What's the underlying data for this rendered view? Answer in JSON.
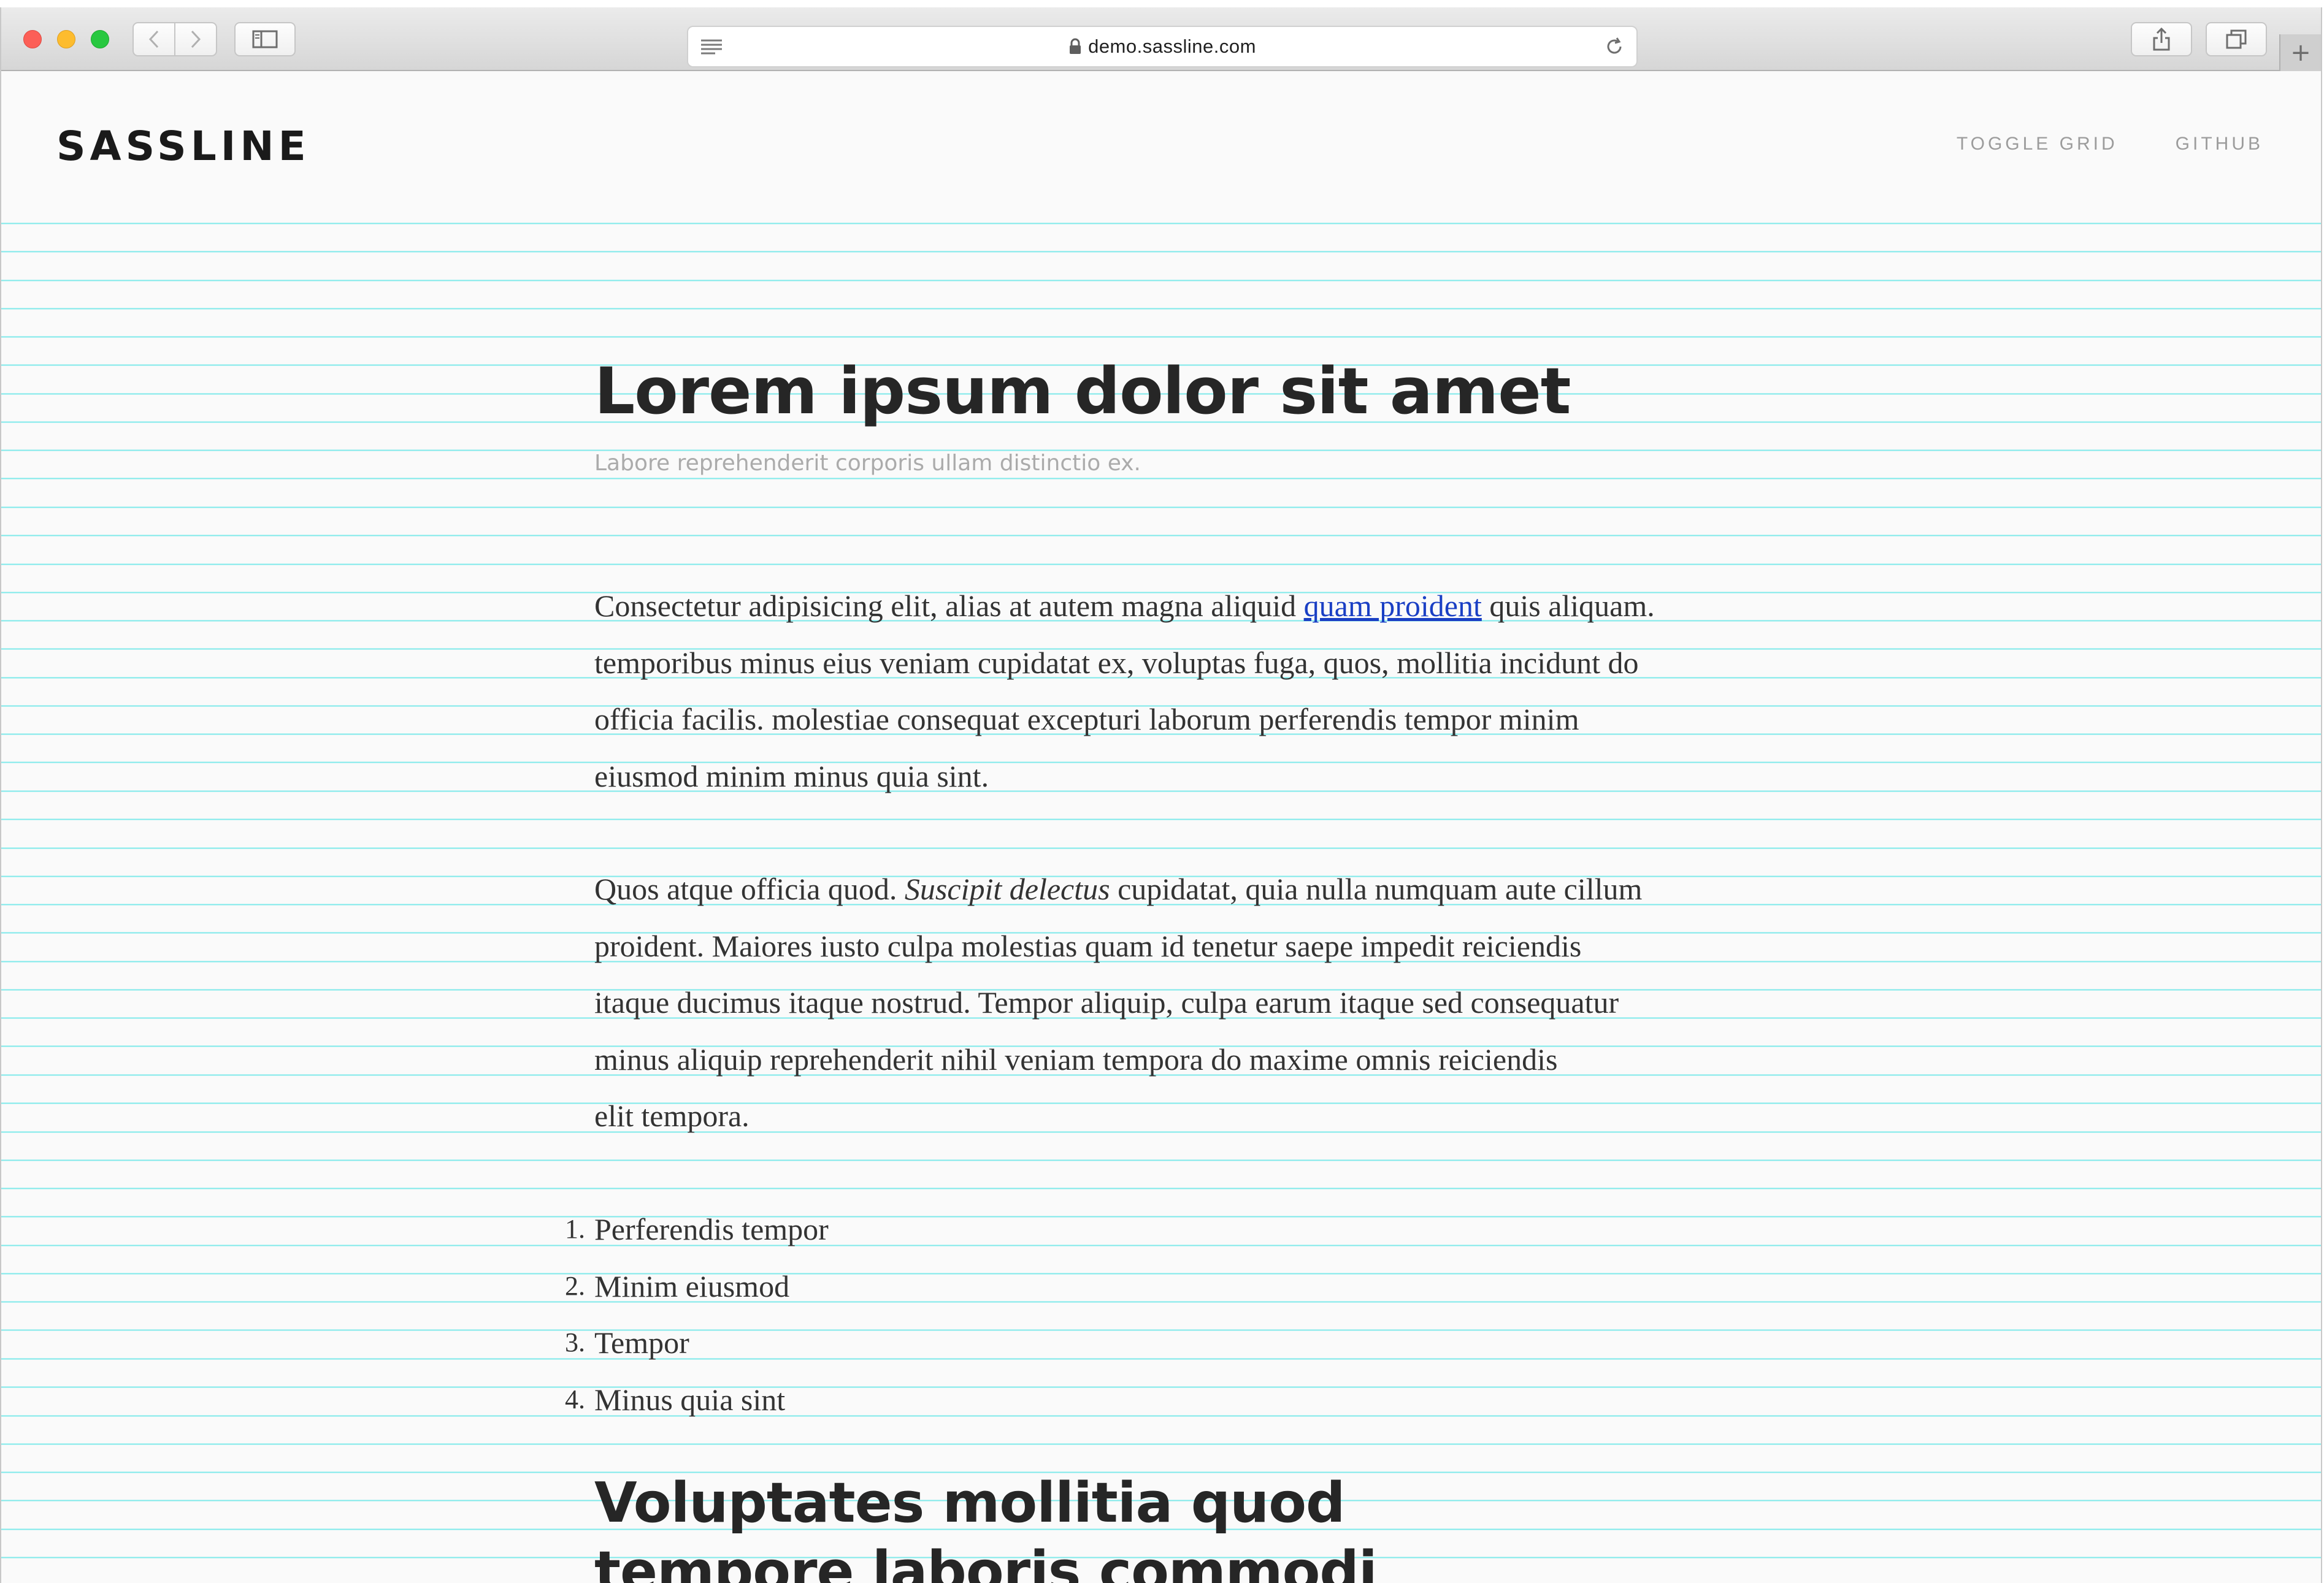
{
  "browser": {
    "url": "demo.sassline.com",
    "new_tab_symbol": "+",
    "icons": [
      "back-icon",
      "forward-icon",
      "sidebar-icon",
      "reader-icon",
      "lock-icon",
      "reload-icon",
      "share-icon",
      "tabs-icon",
      "new-tab-icon"
    ]
  },
  "site": {
    "logo": "SASSLINE",
    "nav": [
      "TOGGLE GRID",
      "GITHUB"
    ]
  },
  "article": {
    "title": "Lorem ipsum dolor sit amet",
    "subtitle": "Labore reprehenderit corporis ullam distinctio ex.",
    "p1": {
      "line1_before": "Consectetur adipisicing elit, alias at autem magna aliquid ",
      "link": "quam proident",
      "line1_after": " quis aliquam.",
      "line2": "temporibus minus eius veniam cupidatat ex, voluptas fuga, quos, mollitia incidunt do",
      "line3": "officia facilis. molestiae consequat excepturi laborum perferendis tempor minim",
      "line4": "eiusmod minim minus quia sint."
    },
    "p2": {
      "line1_before": "Quos atque officia quod. ",
      "emphasis": "Suscipit delectus",
      "line1_after": " cupidatat, quia nulla numquam aute cillum",
      "line2": "proident. Maiores iusto culpa molestias quam id tenetur saepe impedit reiciendis",
      "line3": "itaque ducimus itaque nostrud. Tempor aliquip, culpa earum itaque sed consequatur",
      "line4": "minus aliquip reprehenderit nihil veniam tempora do maxime omnis reiciendis",
      "line5": "elit tempora."
    },
    "list": [
      {
        "num": "1.",
        "text": "Perferendis tempor"
      },
      {
        "num": "2.",
        "text": "Minim eiusmod"
      },
      {
        "num": "3.",
        "text": "Tempor"
      },
      {
        "num": "4.",
        "text": "Minus quia sint"
      }
    ],
    "heading2": "Voluptates mollitia quod tempore laboris commodi"
  },
  "colors": {
    "grid_line": "#7fe9ea",
    "link": "#1a3fc4",
    "text": "#333333",
    "subtitle": "#ababab",
    "nav": "#9c9c9c"
  }
}
